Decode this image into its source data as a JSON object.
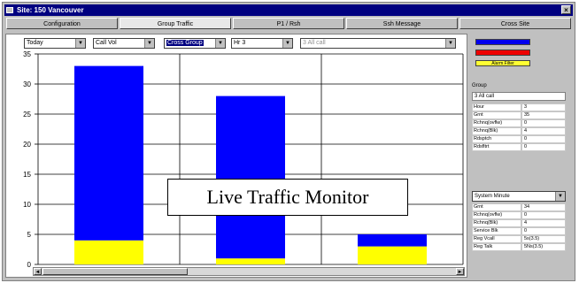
{
  "window": {
    "title": "Site: 150 Vancouver",
    "close_glyph": "×"
  },
  "tabs": [
    {
      "label": "Configuration"
    },
    {
      "label": "Group Traffic",
      "active": true
    },
    {
      "label": "P1 / Rsh"
    },
    {
      "label": "Ssh Message"
    },
    {
      "label": "Cross Site"
    }
  ],
  "filters": [
    {
      "value": "Today"
    },
    {
      "value": "Call Vol"
    },
    {
      "value": "Cross Group",
      "selected": true
    },
    {
      "value": "Hr 3"
    },
    {
      "value": "3 All call",
      "disabled": true
    }
  ],
  "dropdown_arrow": "▼",
  "chart_data": {
    "type": "bar",
    "stacked": true,
    "categories": [
      "",
      "",
      ""
    ],
    "series": [
      {
        "color": "#ffff00",
        "values": [
          4,
          1,
          3
        ]
      },
      {
        "color": "#0000ff",
        "values": [
          29,
          27,
          2
        ]
      }
    ],
    "ylim": [
      0,
      35
    ],
    "yticks": [
      "0",
      "5",
      "10",
      "15",
      "20",
      "25",
      "30",
      "35"
    ],
    "grid": true
  },
  "overlay": {
    "text": "Live Traffic Monitor"
  },
  "scrollbar": {
    "left_arrow": "◄",
    "right_arrow": "►"
  },
  "legend": [
    {
      "color": "#0000ee",
      "label": ""
    },
    {
      "color": "#ee0000",
      "label": ""
    },
    {
      "color": "#ffff33",
      "label": "Alarm Filter"
    }
  ],
  "group": {
    "label": "Group",
    "value": "3 All call",
    "rows": [
      {
        "key": "Hour",
        "value": "3"
      },
      {
        "key": "Grnt",
        "value": "35"
      },
      {
        "key": "Rchnq(ovflw)",
        "value": "0"
      },
      {
        "key": "Rchnq(Blk)",
        "value": "4"
      },
      {
        "key": "Rdsptch",
        "value": "0"
      },
      {
        "key": "Rdsfltrt",
        "value": "0"
      }
    ]
  },
  "system": {
    "selector_value": "System Minute",
    "rows": [
      {
        "key": "Grnt",
        "value": "34"
      },
      {
        "key": "Rchnq(ovflw)",
        "value": "0"
      },
      {
        "key": "Rchnq(Blk)",
        "value": "4"
      },
      {
        "key": "Service Blk",
        "value": "0"
      },
      {
        "key": "Reg Vcall",
        "value": "5s(3.5)"
      },
      {
        "key": "Reg Talk",
        "value": "5Ns(3.5)"
      }
    ]
  }
}
